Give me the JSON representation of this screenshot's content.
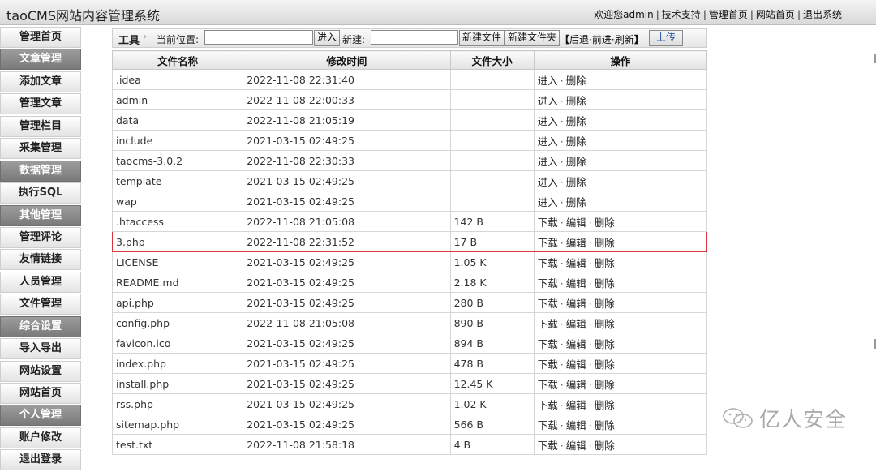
{
  "header": {
    "title": "taoCMS网站内容管理系统",
    "welcome": "欢迎您admin",
    "links": [
      "技术支持",
      "管理首页",
      "网站首页",
      "退出系统"
    ]
  },
  "sidebar": {
    "items": [
      {
        "label": "管理首页",
        "type": "link"
      },
      {
        "label": "文章管理",
        "type": "section"
      },
      {
        "label": "添加文章",
        "type": "link"
      },
      {
        "label": "管理文章",
        "type": "link"
      },
      {
        "label": "管理栏目",
        "type": "link"
      },
      {
        "label": "采集管理",
        "type": "link"
      },
      {
        "label": "数据管理",
        "type": "section"
      },
      {
        "label": "执行SQL",
        "type": "link"
      },
      {
        "label": "其他管理",
        "type": "section"
      },
      {
        "label": "管理评论",
        "type": "link"
      },
      {
        "label": "友情链接",
        "type": "link"
      },
      {
        "label": "人员管理",
        "type": "link"
      },
      {
        "label": "文件管理",
        "type": "link"
      },
      {
        "label": "综合设置",
        "type": "section"
      },
      {
        "label": "导入导出",
        "type": "link"
      },
      {
        "label": "网站设置",
        "type": "link"
      },
      {
        "label": "网站首页",
        "type": "link"
      },
      {
        "label": "个人管理",
        "type": "section"
      },
      {
        "label": "账户修改",
        "type": "link"
      },
      {
        "label": "退出登录",
        "type": "link"
      }
    ]
  },
  "toolbar": {
    "tool_label": "工具",
    "location_label": "当前位置:",
    "location_value": "",
    "enter_button": "进入",
    "new_label": "新建:",
    "new_value": "",
    "new_file_button": "新建文件",
    "new_folder_button": "新建文件夹",
    "back": "后退",
    "forward": "前进",
    "refresh": "刷新",
    "upload_button": "上传"
  },
  "table": {
    "headers": [
      "文件名称",
      "修改时间",
      "文件大小",
      "操作"
    ],
    "rows": [
      {
        "name": ".idea",
        "time": "2022-11-08 22:31:40",
        "size": "",
        "kind": "dir"
      },
      {
        "name": "admin",
        "time": "2022-11-08 22:00:33",
        "size": "",
        "kind": "dir"
      },
      {
        "name": "data",
        "time": "2022-11-08 21:05:19",
        "size": "",
        "kind": "dir"
      },
      {
        "name": "include",
        "time": "2021-03-15 02:49:25",
        "size": "",
        "kind": "dir"
      },
      {
        "name": "taocms-3.0.2",
        "time": "2022-11-08 22:30:33",
        "size": "",
        "kind": "dir"
      },
      {
        "name": "template",
        "time": "2021-03-15 02:49:25",
        "size": "",
        "kind": "dir"
      },
      {
        "name": "wap",
        "time": "2021-03-15 02:49:25",
        "size": "",
        "kind": "dir"
      },
      {
        "name": ".htaccess",
        "time": "2022-11-08 21:05:08",
        "size": "142 B",
        "kind": "file"
      },
      {
        "name": "3.php",
        "time": "2022-11-08 22:31:52",
        "size": "17 B",
        "kind": "file",
        "highlight": true
      },
      {
        "name": "LICENSE",
        "time": "2021-03-15 02:49:25",
        "size": "1.05 K",
        "kind": "file"
      },
      {
        "name": "README.md",
        "time": "2021-03-15 02:49:25",
        "size": "2.18 K",
        "kind": "file"
      },
      {
        "name": "api.php",
        "time": "2021-03-15 02:49:25",
        "size": "280 B",
        "kind": "file"
      },
      {
        "name": "config.php",
        "time": "2022-11-08 21:05:08",
        "size": "890 B",
        "kind": "file"
      },
      {
        "name": "favicon.ico",
        "time": "2021-03-15 02:49:25",
        "size": "894 B",
        "kind": "file"
      },
      {
        "name": "index.php",
        "time": "2021-03-15 02:49:25",
        "size": "478 B",
        "kind": "file"
      },
      {
        "name": "install.php",
        "time": "2021-03-15 02:49:25",
        "size": "12.45 K",
        "kind": "file"
      },
      {
        "name": "rss.php",
        "time": "2021-03-15 02:49:25",
        "size": "1.02 K",
        "kind": "file"
      },
      {
        "name": "sitemap.php",
        "time": "2021-03-15 02:49:25",
        "size": "566 B",
        "kind": "file"
      },
      {
        "name": "test.txt",
        "time": "2022-11-08 21:58:18",
        "size": "4 B",
        "kind": "file"
      }
    ],
    "dir_actions": [
      "进入",
      "删除"
    ],
    "file_actions": [
      "下载",
      "编辑",
      "删除"
    ]
  },
  "watermark": {
    "text": "亿人安全",
    "icon": "wechat-icon"
  },
  "colors": {
    "highlight_border": "#d9363e",
    "section_bg": "#8a8a8a",
    "upload_text": "#1f4fa0"
  }
}
